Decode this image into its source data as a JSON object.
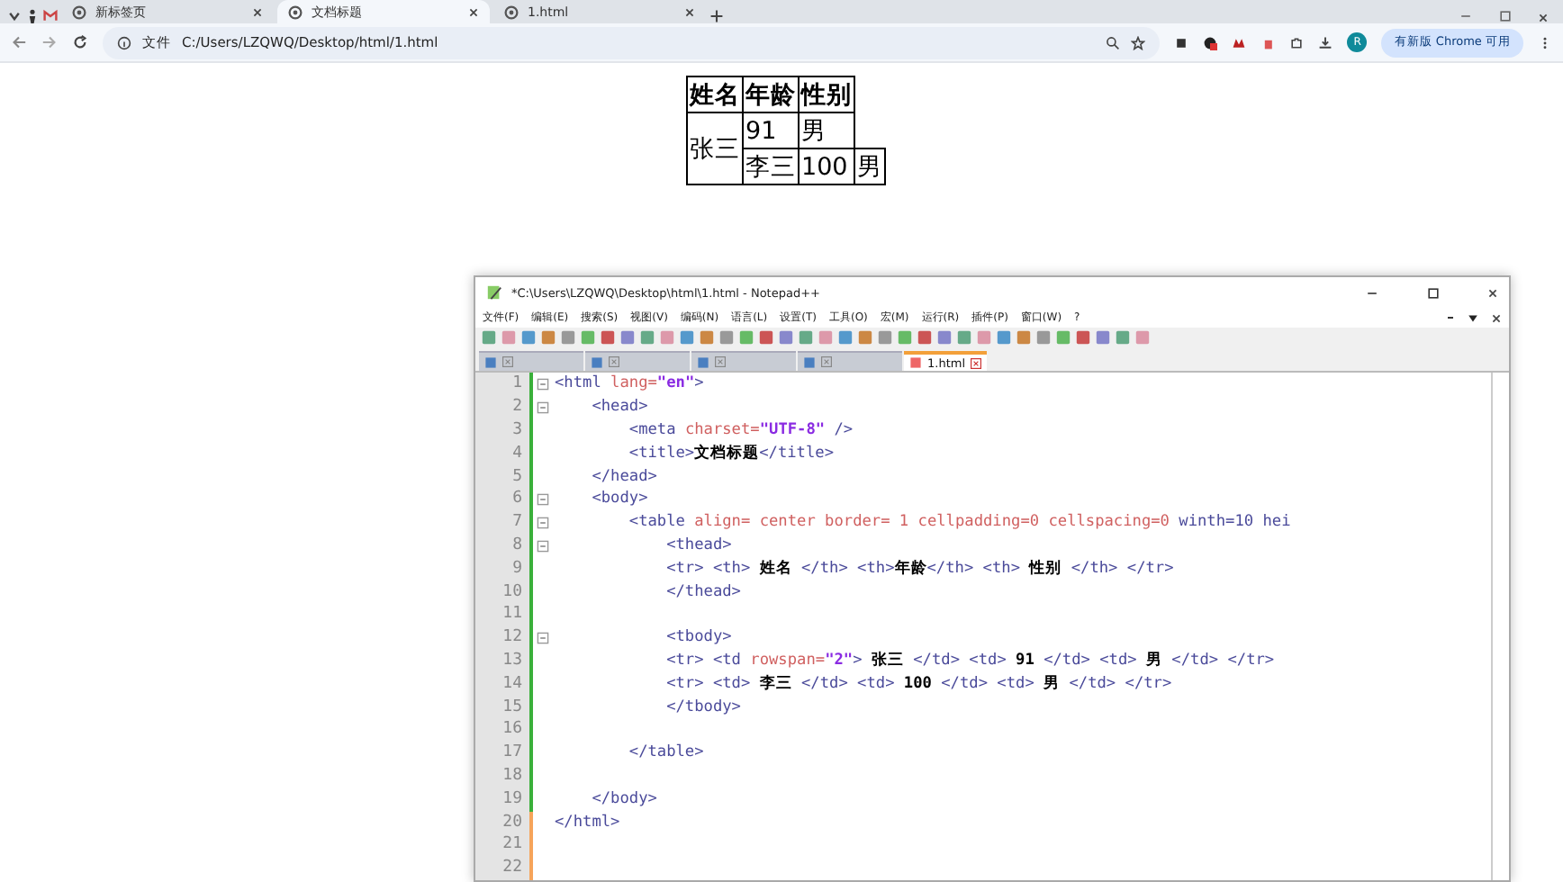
{
  "browser": {
    "tabs": [
      {
        "label": "新标签页",
        "selected": false
      },
      {
        "label": "文档标题",
        "selected": true
      },
      {
        "label": "1.html",
        "selected": false
      }
    ],
    "address": {
      "scheme_label": "文件",
      "url": "C:/Users/LZQWQ/Desktop/html/1.html"
    },
    "update_button": "有新版 Chrome 可用",
    "avatar": "R"
  },
  "page_table": {
    "header": [
      "姓名",
      "年龄",
      "性别"
    ],
    "rows": [
      [
        {
          "text": "张三",
          "rowspan": 2
        },
        "91",
        "男"
      ],
      [
        "李三",
        "100",
        "男"
      ]
    ]
  },
  "notepad": {
    "title": "*C:\\Users\\LZQWQ\\Desktop\\html\\1.html - Notepad++",
    "menu": [
      "文件(F)",
      "编辑(E)",
      "搜索(S)",
      "视图(V)",
      "编码(N)",
      "语言(L)",
      "设置(T)",
      "工具(O)",
      "宏(M)",
      "运行(R)",
      "插件(P)",
      "窗口(W)",
      "?"
    ],
    "tabs": [
      {
        "selected": false
      },
      {
        "selected": false
      },
      {
        "selected": false
      },
      {
        "selected": false
      },
      {
        "label": "1.html",
        "selected": true
      }
    ],
    "lines": [
      {
        "number": "1",
        "fold_marker": true,
        "modified": false,
        "tokens": [
          {
            "kind": "tag",
            "text": "<html "
          },
          {
            "kind": "attr",
            "text": "lang="
          },
          {
            "kind": "value",
            "text": "\"en\""
          },
          {
            "kind": "tag",
            "text": ">"
          }
        ]
      },
      {
        "number": "2",
        "fold_marker": true,
        "modified": false,
        "tokens": [
          {
            "kind": "tag",
            "text": "    <head>"
          }
        ]
      },
      {
        "number": "3",
        "modified": false,
        "tokens": [
          {
            "kind": "tag",
            "text": "        <meta "
          },
          {
            "kind": "attr",
            "text": "charset="
          },
          {
            "kind": "value",
            "text": "\"UTF-8\""
          },
          {
            "kind": "tag",
            "text": " />"
          }
        ]
      },
      {
        "number": "4",
        "modified": false,
        "tokens": [
          {
            "kind": "tag",
            "text": "        <title>"
          },
          {
            "kind": "text",
            "text": "文档标题"
          },
          {
            "kind": "tag",
            "text": "</title>"
          }
        ]
      },
      {
        "number": "5",
        "modified": false,
        "tokens": [
          {
            "kind": "tag",
            "text": "    </head>"
          }
        ]
      },
      {
        "number": "6",
        "fold_marker": true,
        "modified": false,
        "tokens": [
          {
            "kind": "tag",
            "text": "    <body>"
          }
        ]
      },
      {
        "number": "7",
        "fold_marker": true,
        "modified": false,
        "tokens": [
          {
            "kind": "tag",
            "text": "        <table "
          },
          {
            "kind": "attr",
            "text": "align= center border= 1 cellpadding=0 cellspacing=0 "
          },
          {
            "kind": "tag",
            "text": "winth=10 hei"
          }
        ]
      },
      {
        "number": "8",
        "fold_marker": true,
        "modified": false,
        "tokens": [
          {
            "kind": "tag",
            "text": "            <thead>"
          }
        ]
      },
      {
        "number": "9",
        "modified": false,
        "tokens": [
          {
            "kind": "tag",
            "text": "            <tr> <th> "
          },
          {
            "kind": "text",
            "text": "姓名"
          },
          {
            "kind": "tag",
            "text": " </th> <th>"
          },
          {
            "kind": "text",
            "text": "年龄"
          },
          {
            "kind": "tag",
            "text": "</th> <th> "
          },
          {
            "kind": "text",
            "text": "性别"
          },
          {
            "kind": "tag",
            "text": " </th> </tr>"
          }
        ]
      },
      {
        "number": "10",
        "modified": false,
        "tokens": [
          {
            "kind": "tag",
            "text": "            </thead>"
          }
        ]
      },
      {
        "number": "11",
        "modified": false
      },
      {
        "number": "12",
        "fold_marker": true,
        "modified": false,
        "tokens": [
          {
            "kind": "tag",
            "text": "            <tbody>"
          }
        ]
      },
      {
        "number": "13",
        "modified": false,
        "tokens": [
          {
            "kind": "tag",
            "text": "            <tr> <td "
          },
          {
            "kind": "attr",
            "text": "rowspan="
          },
          {
            "kind": "value",
            "text": "\"2\""
          },
          {
            "kind": "tag",
            "text": "> "
          },
          {
            "kind": "text",
            "text": "张三"
          },
          {
            "kind": "tag",
            "text": " </td> <td> "
          },
          {
            "kind": "text",
            "text": "91"
          },
          {
            "kind": "tag",
            "text": " </td> <td> "
          },
          {
            "kind": "text",
            "text": "男"
          },
          {
            "kind": "tag",
            "text": " </td> </tr>"
          }
        ]
      },
      {
        "number": "14",
        "modified": false,
        "tokens": [
          {
            "kind": "tag",
            "text": "            <tr> <td> "
          },
          {
            "kind": "text",
            "text": "李三"
          },
          {
            "kind": "tag",
            "text": " </td> <td> "
          },
          {
            "kind": "text",
            "text": "100"
          },
          {
            "kind": "tag",
            "text": " </td> <td> "
          },
          {
            "kind": "text",
            "text": "男"
          },
          {
            "kind": "tag",
            "text": " </td> </tr>"
          }
        ]
      },
      {
        "number": "15",
        "modified": false,
        "tokens": [
          {
            "kind": "tag",
            "text": "            </tbody>"
          }
        ]
      },
      {
        "number": "16",
        "modified": false
      },
      {
        "number": "17",
        "modified": false,
        "tokens": [
          {
            "kind": "tag",
            "text": "        </table>"
          }
        ]
      },
      {
        "number": "18",
        "modified": false
      },
      {
        "number": "19",
        "modified": false,
        "tokens": [
          {
            "kind": "tag",
            "text": "    </body>"
          }
        ]
      },
      {
        "number": "20",
        "modified": true,
        "tokens": [
          {
            "kind": "tag",
            "text": "</html>"
          }
        ]
      },
      {
        "number": "21",
        "modified": true
      },
      {
        "number": "22",
        "modified": true
      }
    ]
  }
}
